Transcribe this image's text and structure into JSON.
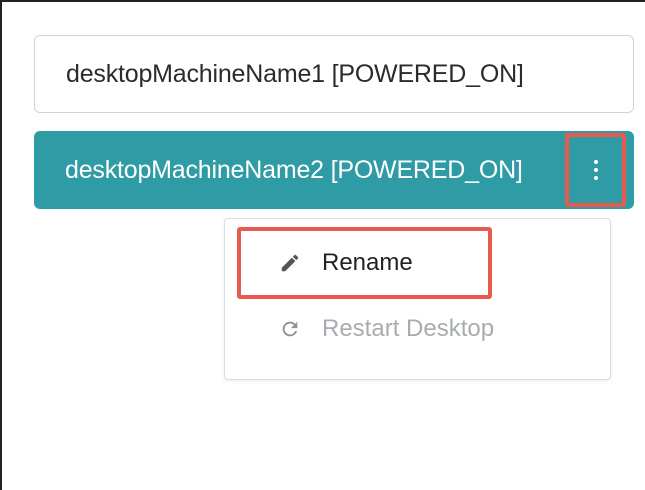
{
  "machines": [
    {
      "label": "desktopMachineName1 [POWERED_ON]",
      "state": "idle"
    },
    {
      "label": "desktopMachineName2 [POWERED_ON]",
      "state": "selected"
    }
  ],
  "kebab": {
    "icon": "more-vertical-icon"
  },
  "menu": {
    "items": [
      {
        "label": "Rename",
        "icon": "pencil-icon",
        "enabled": true
      },
      {
        "label": "Restart Desktop",
        "icon": "refresh-icon",
        "enabled": false
      }
    ]
  },
  "colors": {
    "selected_bg": "#2f9ba4",
    "highlight": "#e85a4f",
    "disabled_text": "#a8acb0",
    "idle_border": "#c7d5e6"
  }
}
